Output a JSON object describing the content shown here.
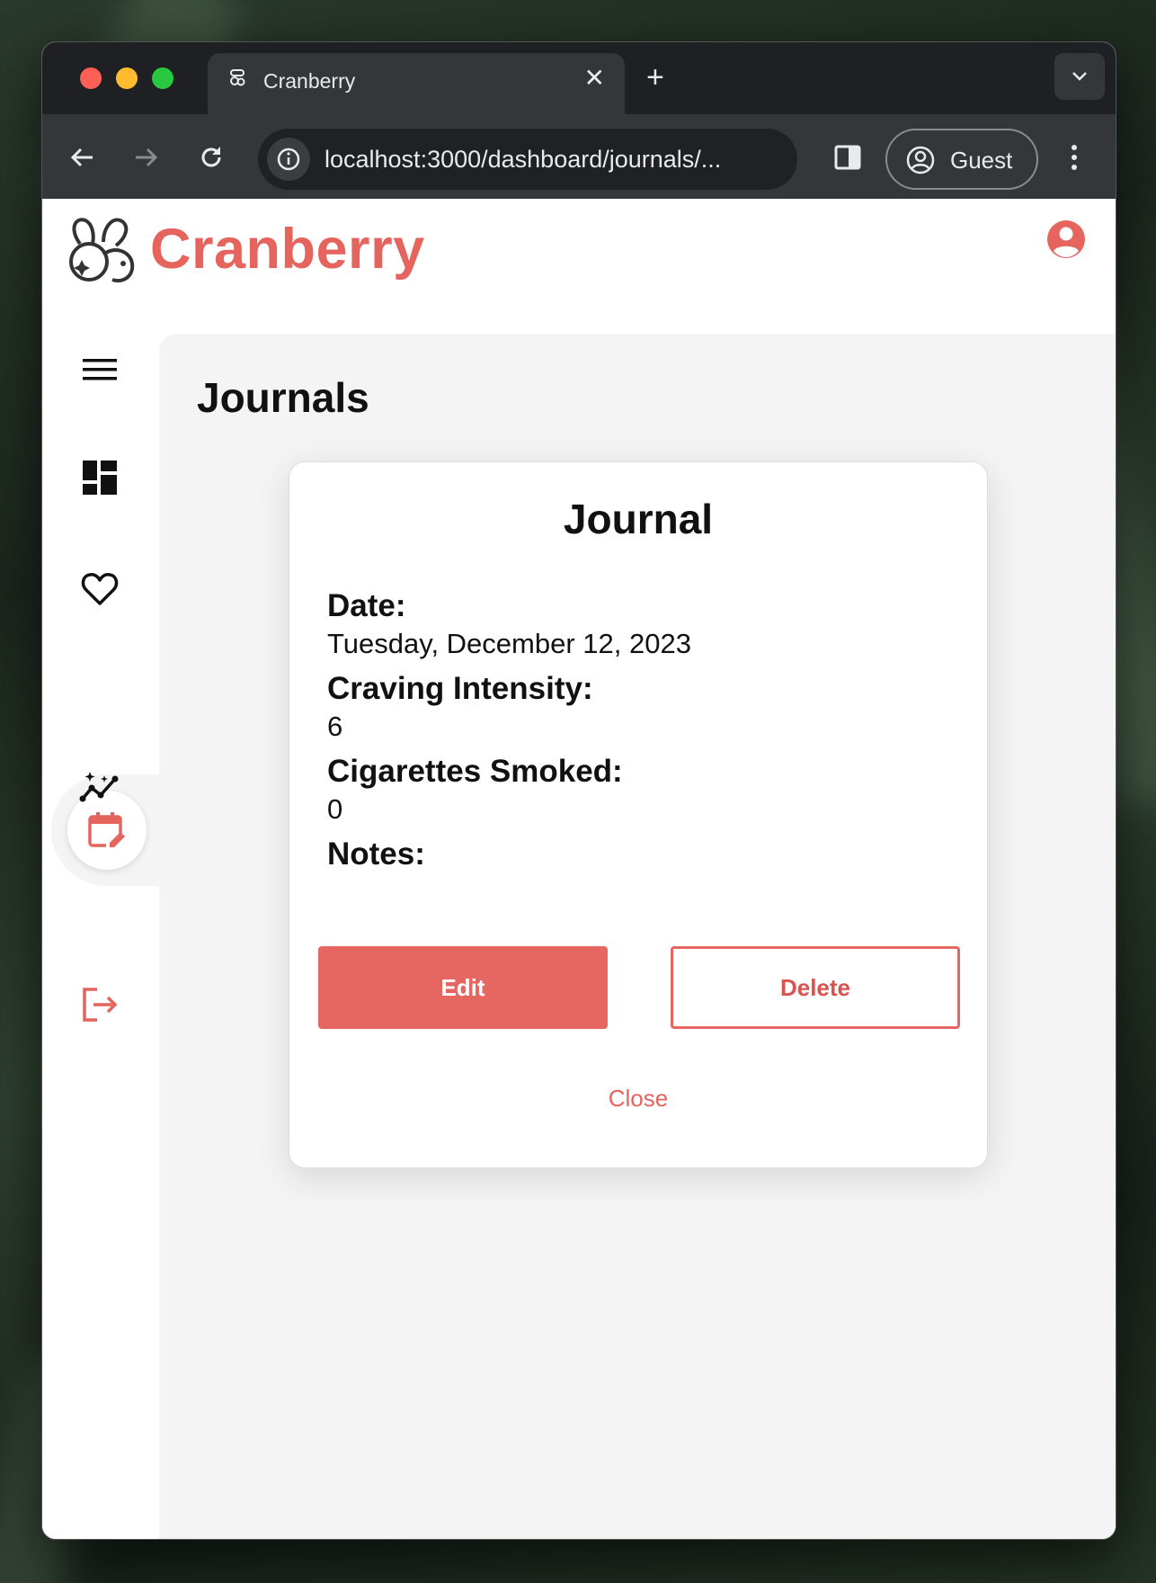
{
  "browser": {
    "tab_title": "Cranberry",
    "tab_close": "✕",
    "new_tab": "+",
    "url": "localhost:3000/dashboard/journals/...",
    "profile_label": "Guest"
  },
  "app": {
    "brand_name": "Cranberry",
    "brand_color": "#e5645e"
  },
  "sidebar": {
    "items": [
      {
        "icon": "menu-icon"
      },
      {
        "icon": "dashboard-icon"
      },
      {
        "icon": "heart-icon"
      },
      {
        "icon": "calendar-edit-icon",
        "active": true
      },
      {
        "icon": "insights-icon"
      },
      {
        "icon": "logout-icon"
      }
    ]
  },
  "main": {
    "page_title": "Journals"
  },
  "journal_modal": {
    "title": "Journal",
    "date_label": "Date:",
    "date_value": "Tuesday, December 12, 2023",
    "craving_label": "Craving Intensity:",
    "craving_value": "6",
    "cigarettes_label": "Cigarettes Smoked:",
    "cigarettes_value": "0",
    "notes_label": "Notes:",
    "notes_value": "",
    "edit_label": "Edit",
    "delete_label": "Delete",
    "close_label": "Close"
  }
}
